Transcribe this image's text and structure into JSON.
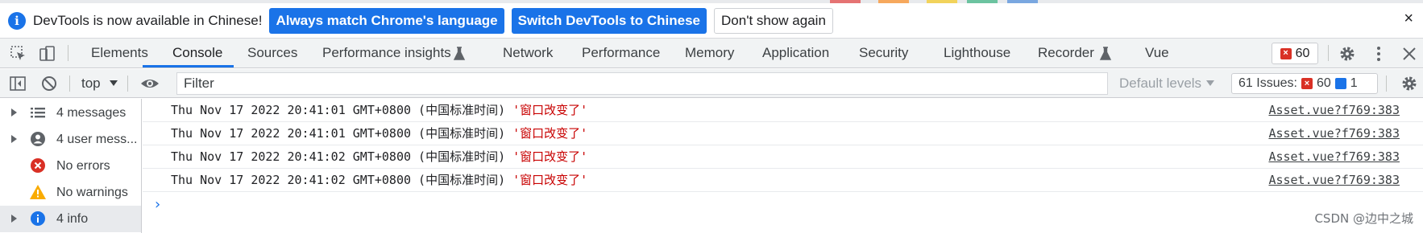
{
  "infobar": {
    "message": "DevTools is now available in Chinese!",
    "primary_button_1": "Always match Chrome's language",
    "primary_button_2": "Switch DevTools to Chinese",
    "secondary_button": "Don't show again",
    "close_glyph": "×"
  },
  "tabs": [
    {
      "label": "Elements"
    },
    {
      "label": "Console",
      "active": true
    },
    {
      "label": "Sources"
    },
    {
      "label": "Performance insights"
    },
    {
      "label": "Network"
    },
    {
      "label": "Performance"
    },
    {
      "label": "Memory"
    },
    {
      "label": "Application"
    },
    {
      "label": "Security"
    },
    {
      "label": "Lighthouse"
    },
    {
      "label": "Recorder"
    },
    {
      "label": "Vue"
    }
  ],
  "tabbar": {
    "error_count": "60"
  },
  "console_toolbar": {
    "context": "top",
    "filter_placeholder": "Filter",
    "levels": "Default levels",
    "issues_label": "61 Issues:",
    "issues_errors": "60",
    "issues_info": "1"
  },
  "sidebar": [
    {
      "label": "4 messages",
      "icon": "list-icon",
      "expandable": true
    },
    {
      "label": "4 user mess...",
      "icon": "user-icon",
      "expandable": true
    },
    {
      "label": "No errors",
      "icon": "error-icon",
      "expandable": false
    },
    {
      "label": "No warnings",
      "icon": "warning-icon",
      "expandable": false
    },
    {
      "label": "4 info",
      "icon": "info-icon",
      "expandable": true,
      "selected": true
    }
  ],
  "logs": [
    {
      "text": "Thu Nov 17 2022 20:41:01 GMT+0800 (中国标准时间) ",
      "string": "'窗口改变了'",
      "source": "Asset.vue?f769:383"
    },
    {
      "text": "Thu Nov 17 2022 20:41:01 GMT+0800 (中国标准时间) ",
      "string": "'窗口改变了'",
      "source": "Asset.vue?f769:383"
    },
    {
      "text": "Thu Nov 17 2022 20:41:02 GMT+0800 (中国标准时间) ",
      "string": "'窗口改变了'",
      "source": "Asset.vue?f769:383"
    },
    {
      "text": "Thu Nov 17 2022 20:41:02 GMT+0800 (中国标准时间) ",
      "string": "'窗口改变了'",
      "source": "Asset.vue?f769:383"
    }
  ],
  "prompt_glyph": "›",
  "watermark": "CSDN @边中之城",
  "colors": {
    "accent": "#1a73e8",
    "error": "#d93025",
    "warning": "#f9ab00",
    "log_string": "#c80000"
  }
}
